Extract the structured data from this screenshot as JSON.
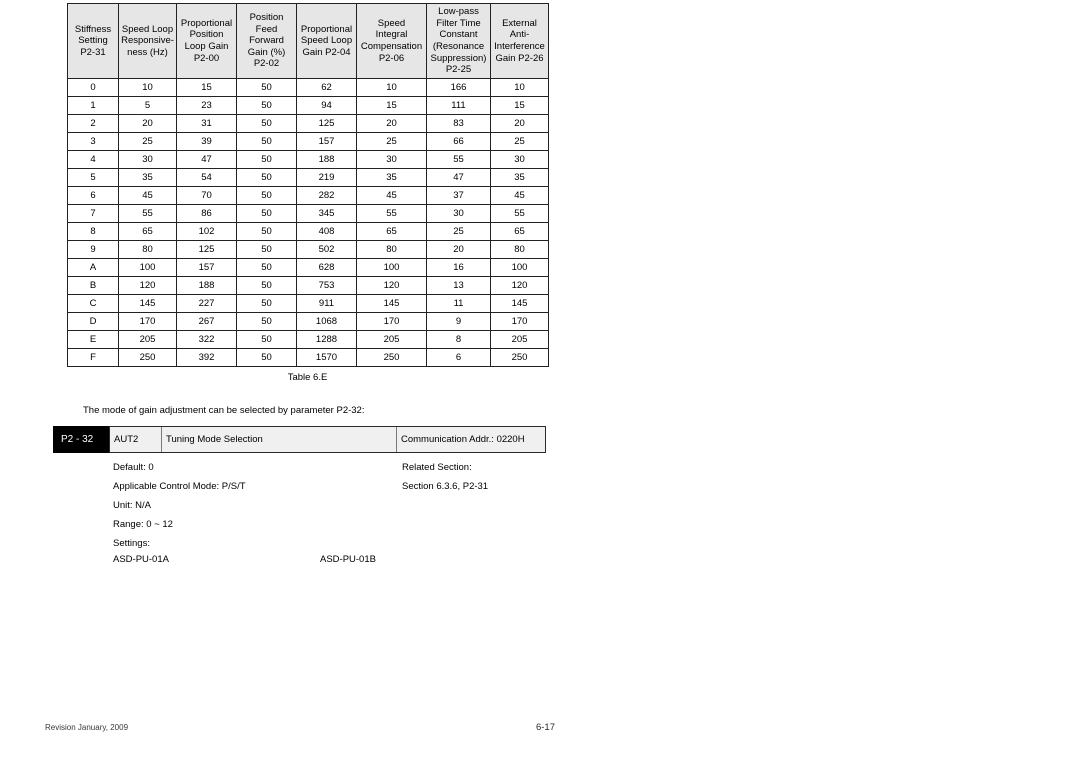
{
  "gain_table": {
    "caption": "Table 6.E",
    "headers": [
      "Stiffness Setting P2-31",
      "Speed Loop Responsive- ness (Hz)",
      "Proportional Position Loop Gain P2-00",
      "Position Feed Forward Gain (%) P2-02",
      "Proportional Speed Loop Gain P2-04",
      "Speed Integral Compensation P2-06",
      "Low-pass Filter Time Constant (Resonance Suppression) P2-25",
      "External Anti- Interference Gain P2-26"
    ],
    "header_lines": [
      [
        "Stiffness",
        "Setting",
        "P2-31"
      ],
      [
        "Speed Loop",
        "Responsive-",
        "ness (Hz)"
      ],
      [
        "Proportional",
        "Position",
        "Loop Gain",
        "P2-00"
      ],
      [
        "Position",
        "Feed",
        "Forward",
        "Gain (%)",
        "P2-02"
      ],
      [
        "Proportional",
        "Speed Loop",
        "Gain P2-04"
      ],
      [
        "Speed",
        "Integral",
        "Compensation",
        "P2-06"
      ],
      [
        "Low-pass",
        "Filter Time",
        "Constant",
        "(Resonance",
        "Suppression)",
        "P2-25"
      ],
      [
        "External",
        "Anti-",
        "Interference",
        "Gain P2-26"
      ]
    ],
    "rows": [
      [
        "0",
        "10",
        "15",
        "50",
        "62",
        "10",
        "166",
        "10"
      ],
      [
        "1",
        "5",
        "23",
        "50",
        "94",
        "15",
        "111",
        "15"
      ],
      [
        "2",
        "20",
        "31",
        "50",
        "125",
        "20",
        "83",
        "20"
      ],
      [
        "3",
        "25",
        "39",
        "50",
        "157",
        "25",
        "66",
        "25"
      ],
      [
        "4",
        "30",
        "47",
        "50",
        "188",
        "30",
        "55",
        "30"
      ],
      [
        "5",
        "35",
        "54",
        "50",
        "219",
        "35",
        "47",
        "35"
      ],
      [
        "6",
        "45",
        "70",
        "50",
        "282",
        "45",
        "37",
        "45"
      ],
      [
        "7",
        "55",
        "86",
        "50",
        "345",
        "55",
        "30",
        "55"
      ],
      [
        "8",
        "65",
        "102",
        "50",
        "408",
        "65",
        "25",
        "65"
      ],
      [
        "9",
        "80",
        "125",
        "50",
        "502",
        "80",
        "20",
        "80"
      ],
      [
        "A",
        "100",
        "157",
        "50",
        "628",
        "100",
        "16",
        "100"
      ],
      [
        "B",
        "120",
        "188",
        "50",
        "753",
        "120",
        "13",
        "120"
      ],
      [
        "C",
        "145",
        "227",
        "50",
        "911",
        "145",
        "11",
        "145"
      ],
      [
        "D",
        "170",
        "267",
        "50",
        "1068",
        "170",
        "9",
        "170"
      ],
      [
        "E",
        "205",
        "322",
        "50",
        "1288",
        "205",
        "8",
        "205"
      ],
      [
        "F",
        "250",
        "392",
        "50",
        "1570",
        "250",
        "6",
        "250"
      ]
    ]
  },
  "intro": {
    "text": "The mode of gain adjustment can be selected by parameter P2-32:"
  },
  "parameter": {
    "code": "P2 - 32",
    "abbreviation": "AUT2",
    "title": "Tuning Mode Selection",
    "comm_address": "Communication Addr.: 0220H"
  },
  "details": {
    "left": [
      "Default: 0",
      "Applicable Control Mode: P/S/T",
      "Unit: N/A",
      "Range: 0 ~ 12",
      "Settings:"
    ],
    "right": [
      "Related Section:",
      "Section 6.3.6, P2-31"
    ]
  },
  "settings_models": {
    "model_a": "ASD-PU-01A",
    "model_b": "ASD-PU-01B"
  },
  "footer": {
    "revision": "Revision January, 2009",
    "page_number": "6-17"
  },
  "colors": {
    "header_fill": "#e6e6e6",
    "param_code_fill": "#000000",
    "param_row_fill": "#f0f0f0",
    "border": "#222222",
    "text": "#000000"
  }
}
